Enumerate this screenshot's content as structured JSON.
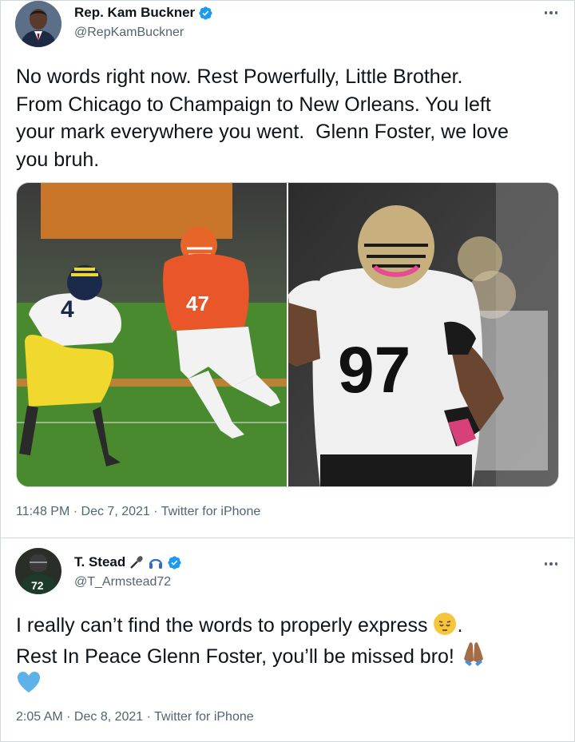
{
  "tweets": [
    {
      "author_name": "Rep. Kam Buckner",
      "handle": "@RepKamBuckner",
      "text": "No words right now. Rest Powerfully, Little Brother.\nFrom Chicago to Champaign to New Orleans. You left\nyour mark everywhere you went.  Glenn Foster, we love\nyou bruh.",
      "time": "11:48 PM",
      "date": "Dec 7, 2021",
      "source": "Twitter for iPhone",
      "media": [
        {
          "alt": "Illinois #47 vs Michigan #4 football photo",
          "jersey_left": "4",
          "jersey_right": "47"
        },
        {
          "alt": "Saints #97 player photo",
          "jersey": "97"
        }
      ]
    },
    {
      "author_name": "T. Stead",
      "handle": "@T_Armstead72",
      "text_line1": "I really can’t find the words to properly express",
      "text_line2": "Rest In Peace Glenn Foster, you’ll be missed bro!",
      "time": "2:05 AM",
      "date": "Dec 8, 2021",
      "source": "Twitter for iPhone",
      "avatar_number": "72"
    }
  ],
  "separator": " · ",
  "colors": {
    "verified": "#1d9bf0",
    "secondary_text": "#536471",
    "border": "#cfd9de"
  },
  "icons": [
    "verified-badge-icon",
    "more-options-icon",
    "microphone-emoji-icon",
    "headphones-emoji-icon",
    "pensive-face-emoji-icon",
    "folded-hands-emoji-icon",
    "blue-heart-emoji-icon"
  ]
}
